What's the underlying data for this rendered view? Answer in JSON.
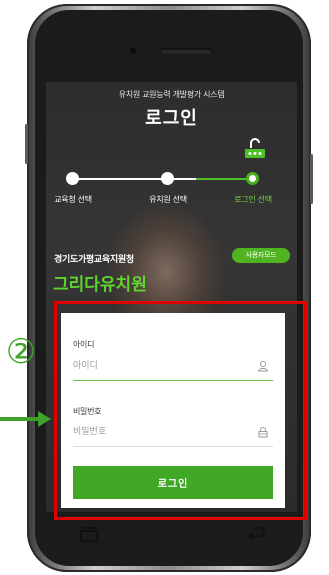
{
  "header": {
    "subtitle": "유치원 교원능력 개발평가 시스템",
    "title": "로그인"
  },
  "steps": [
    {
      "label": "교육청 선택",
      "active": false
    },
    {
      "label": "유치원 선택",
      "active": false
    },
    {
      "label": "로그인 선택",
      "active": true
    }
  ],
  "school": {
    "region": "경기도가평교육지원청",
    "name": "그리다유치원"
  },
  "user_mode_button": "사용자모드",
  "login_form": {
    "id_label": "아이디",
    "id_placeholder": "아이디",
    "id_value": "",
    "password_label": "비밀번호",
    "password_placeholder": "비밀번호",
    "password_value": "",
    "submit_label": "로그인"
  },
  "annotation": {
    "step_marker": "②"
  },
  "colors": {
    "accent_green": "#40a825",
    "highlight_red": "#e00000",
    "focus_underline": "#6cc04a"
  },
  "icons": {
    "id_field": "person-icon",
    "password_field": "lock-icon",
    "login_step": "login-step-icon"
  }
}
